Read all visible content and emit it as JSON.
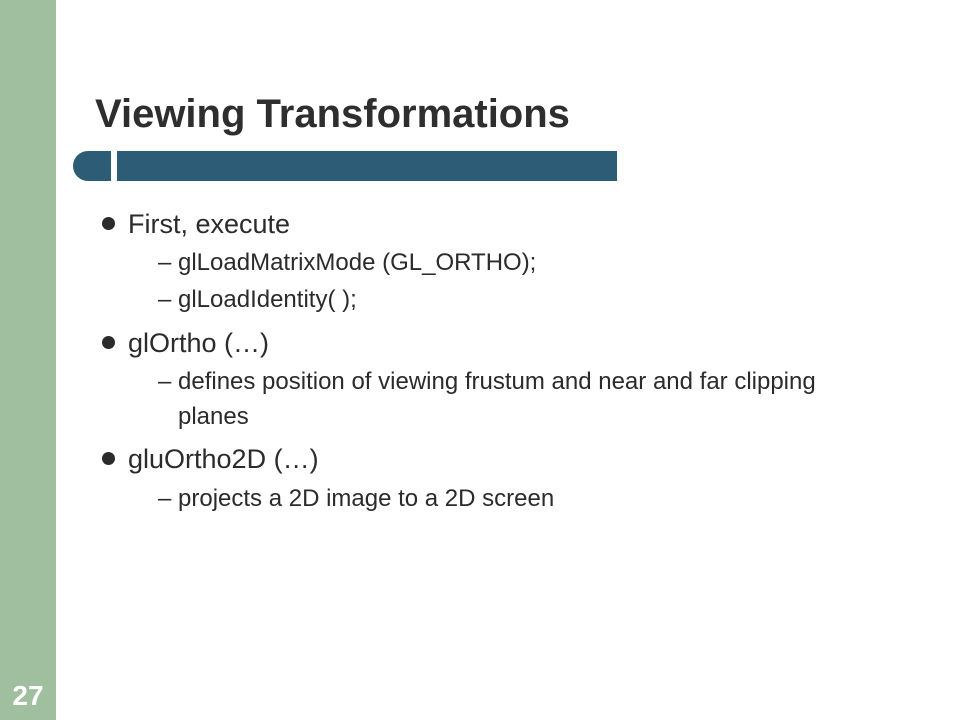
{
  "slide": {
    "title": "Viewing Transformations",
    "page_number": "27",
    "bullets": [
      {
        "text": "First, execute",
        "sub": [
          "glLoadMatrixMode (GL_ORTHO);",
          "glLoadIdentity(  );"
        ]
      },
      {
        "text": "glOrtho (…)",
        "sub": [
          "defines position of viewing frustum and near and far clipping planes"
        ]
      },
      {
        "text": "gluOrtho2D (…)",
        "sub": [
          "projects a 2D image to a 2D screen"
        ]
      }
    ]
  }
}
